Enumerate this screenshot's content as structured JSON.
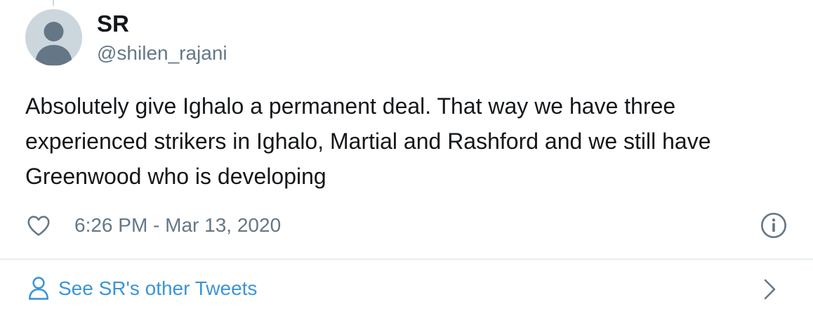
{
  "author": {
    "display_name": "SR",
    "handle": "@shilen_rajani"
  },
  "tweet": {
    "text": "Absolutely give Ighalo a permanent deal. That way we have three experienced strikers in Ighalo, Martial and Rashford and we still have Greenwood who is developing",
    "timestamp": "6:26 PM - Mar 13, 2020"
  },
  "footer": {
    "link_label": "See SR's other Tweets"
  },
  "icons": {
    "like": "heart-icon",
    "info": "info-icon",
    "person": "person-icon",
    "chevron": "chevron-right-icon"
  },
  "colors": {
    "primary_text": "#14171a",
    "secondary_text": "#657786",
    "link": "#3b94d9",
    "avatar_bg": "#ccd6dd",
    "divider": "#e6ecf0"
  }
}
